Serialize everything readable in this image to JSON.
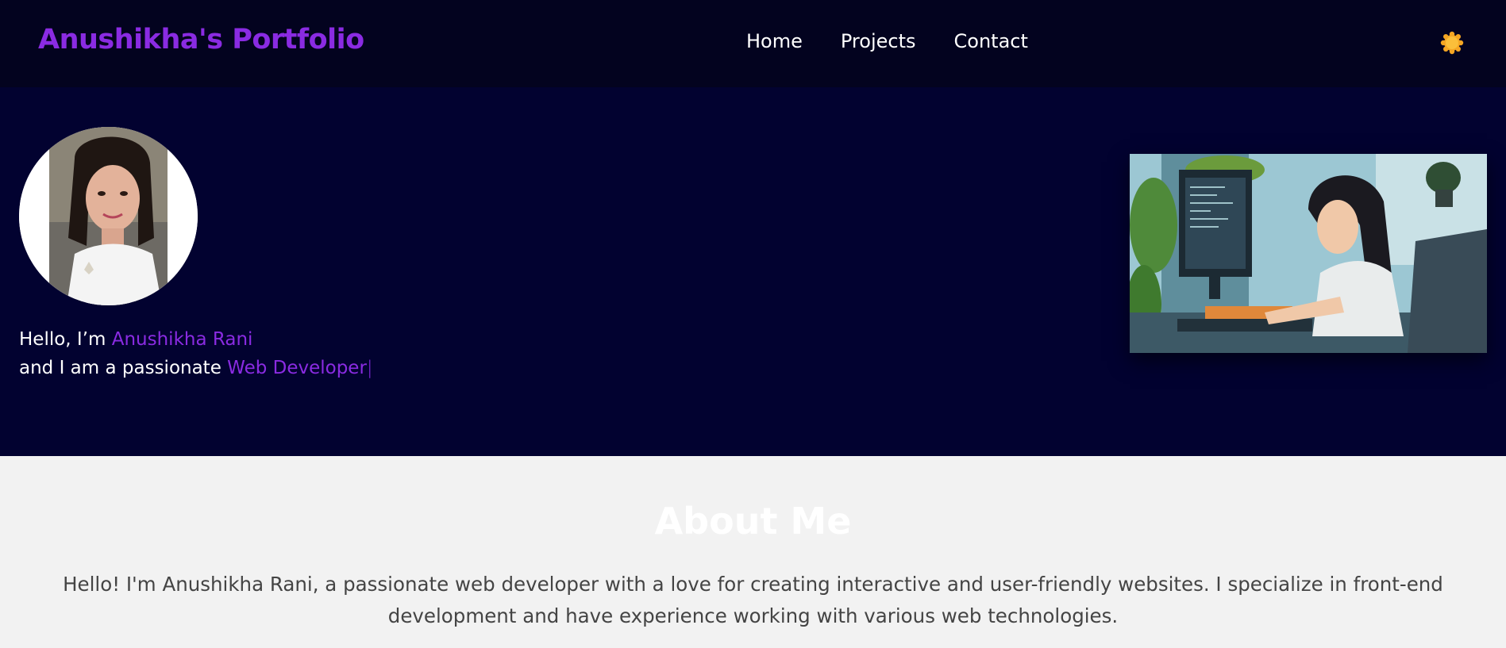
{
  "header": {
    "brand": "Anushikha's Portfolio",
    "nav": [
      {
        "label": "Home"
      },
      {
        "label": "Projects"
      },
      {
        "label": "Contact"
      }
    ],
    "theme_toggle_icon": "sun-icon"
  },
  "hero": {
    "greeting_prefix": "Hello, I’m ",
    "name": "Anushikha Rani",
    "role_prefix": "and I am a passionate ",
    "role": "Web Developer",
    "cursor": "|",
    "avatar_icon": "profile-photo",
    "illustration_icon": "developer-illustration"
  },
  "about": {
    "title": "About Me",
    "text": "Hello! I'm Anushikha Rani, a passionate web developer with a love for creating interactive and user-friendly websites. I specialize in front-end development and have experience working with various web technologies."
  },
  "colors": {
    "accent": "#8a2be2",
    "header_bg": "#03031f",
    "hero_bg": "#020230",
    "about_bg": "#f2f2f2",
    "sun": "#f5a623"
  }
}
